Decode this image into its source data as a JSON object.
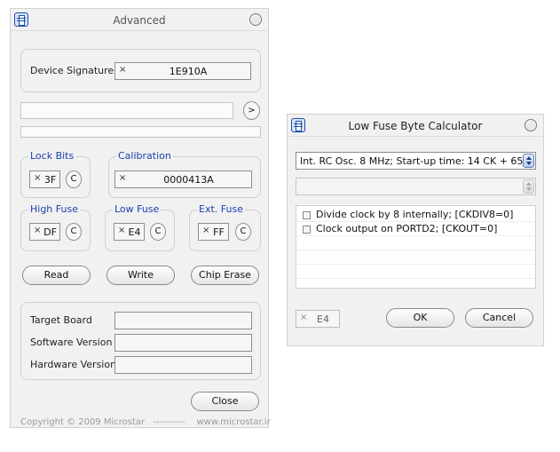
{
  "advanced": {
    "title": "Advanced",
    "device_signature": {
      "label": "Device Signature",
      "prefix": "×",
      "value": "1E910A"
    },
    "next_arrow": ">",
    "lock_bits": {
      "legend": "Lock Bits",
      "prefix": "×",
      "value": "3F",
      "button": "C"
    },
    "calibration": {
      "legend": "Calibration",
      "prefix": "×",
      "value": "0000413A"
    },
    "high_fuse": {
      "legend": "High Fuse",
      "prefix": "×",
      "value": "DF",
      "button": "C"
    },
    "low_fuse": {
      "legend": "Low Fuse",
      "prefix": "×",
      "value": "E4",
      "button": "C"
    },
    "ext_fuse": {
      "legend": "Ext. Fuse",
      "prefix": "×",
      "value": "FF",
      "button": "C"
    },
    "buttons": {
      "read": "Read",
      "write": "Write",
      "chip_erase": "Chip Erase",
      "close": "Close"
    },
    "info": {
      "target_board": "Target Board",
      "software_version": "Software Version",
      "hardware_version": "Hardware Version"
    },
    "footer": "Copyright © 2009 Microstar   ----------    www.microstar.ir"
  },
  "calculator": {
    "title": "Low Fuse Byte Calculator",
    "clock_select": "Int. RC Osc. 8 MHz; Start-up time: 14 CK + 65",
    "options": [
      {
        "label": "Divide clock by 8 internally; [CKDIV8=0]",
        "checked": false
      },
      {
        "label": "Clock output on PORTD2; [CKOUT=0]",
        "checked": false
      }
    ],
    "result": {
      "prefix": "×",
      "value": "E4"
    },
    "buttons": {
      "ok": "OK",
      "cancel": "Cancel"
    }
  }
}
